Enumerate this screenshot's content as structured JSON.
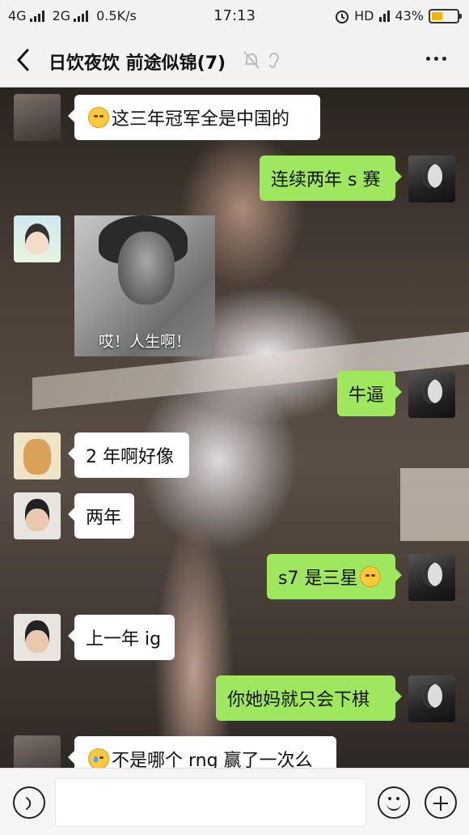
{
  "status_bar": {
    "network1": "4G",
    "network2": "2G",
    "speed": "0.5K/s",
    "time": "17:13",
    "hd": "HD",
    "battery_percent": "43%",
    "battery_level": 0.43,
    "battery_color": "#f4b400"
  },
  "header": {
    "title": "日饮夜饮 前途似锦(7)",
    "back_icon": "back-arrow-icon",
    "mute_icon": "bell-muted-icon",
    "ear_icon": "earpiece-icon",
    "more_icon": "more-dots-icon"
  },
  "messages": [
    {
      "side": "in",
      "emoji": "smirk",
      "text": "这三年冠军全是中国的"
    },
    {
      "side": "out",
      "text": "连续两年 s 赛"
    },
    {
      "side": "in",
      "type": "sticker",
      "caption": "哎！人生啊！"
    },
    {
      "side": "out",
      "text": "牛逼"
    },
    {
      "side": "in",
      "text": "2 年啊好像"
    },
    {
      "side": "in",
      "text": "两年"
    },
    {
      "side": "out",
      "text": "s7 是三星",
      "emoji_after": "relieved"
    },
    {
      "side": "in",
      "text": "上一年 ig"
    },
    {
      "side": "out",
      "text": "你她妈就只会下棋"
    },
    {
      "side": "in",
      "emoji": "crying-laugh",
      "text": "不是哪个 rng 赢了一次么"
    }
  ],
  "input_bar": {
    "voice_icon": "voice-icon",
    "text": "",
    "emoji_icon": "smiley-icon",
    "plus_icon": "plus-icon"
  },
  "colors": {
    "outgoing_bubble": "#9ee75f",
    "incoming_bubble": "#ffffff",
    "bar_background": "#f2f2f2"
  }
}
